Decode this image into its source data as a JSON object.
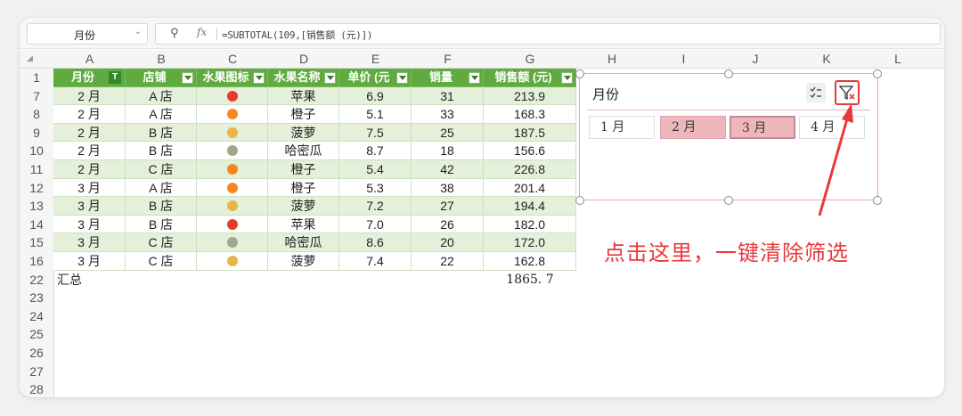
{
  "formula_bar": {
    "name_box": "月份",
    "formula": "=SUBTOTAL(109,[销售额 (元)])"
  },
  "columns": [
    "A",
    "B",
    "C",
    "D",
    "E",
    "F",
    "G",
    "H",
    "I",
    "J",
    "K",
    "L"
  ],
  "table": {
    "headers": [
      "月份",
      "店铺",
      "水果图标",
      "水果名称",
      "单价 (元",
      "销量",
      "销售额 (元)"
    ],
    "rows": [
      {
        "row": "7",
        "month": "2 月",
        "store": "A 店",
        "fruit_icon": "apple-icon",
        "fruit": "苹果",
        "price": "6.9",
        "qty": "31",
        "sales": "213.9"
      },
      {
        "row": "8",
        "month": "2 月",
        "store": "A 店",
        "fruit_icon": "orange-icon",
        "fruit": "橙子",
        "price": "5.1",
        "qty": "33",
        "sales": "168.3"
      },
      {
        "row": "9",
        "month": "2 月",
        "store": "B 店",
        "fruit_icon": "pineapple-icon",
        "fruit": "菠萝",
        "price": "7.5",
        "qty": "25",
        "sales": "187.5"
      },
      {
        "row": "10",
        "month": "2 月",
        "store": "B 店",
        "fruit_icon": "melon-icon",
        "fruit": "哈密瓜",
        "price": "8.7",
        "qty": "18",
        "sales": "156.6"
      },
      {
        "row": "11",
        "month": "2 月",
        "store": "C 店",
        "fruit_icon": "orange-icon",
        "fruit": "橙子",
        "price": "5.4",
        "qty": "42",
        "sales": "226.8"
      },
      {
        "row": "12",
        "month": "3 月",
        "store": "A 店",
        "fruit_icon": "orange-icon",
        "fruit": "橙子",
        "price": "5.3",
        "qty": "38",
        "sales": "201.4"
      },
      {
        "row": "13",
        "month": "3 月",
        "store": "B 店",
        "fruit_icon": "pineapple-icon",
        "fruit": "菠萝",
        "price": "7.2",
        "qty": "27",
        "sales": "194.4"
      },
      {
        "row": "14",
        "month": "3 月",
        "store": "B 店",
        "fruit_icon": "apple-icon",
        "fruit": "苹果",
        "price": "7.0",
        "qty": "26",
        "sales": "182.0"
      },
      {
        "row": "15",
        "month": "3 月",
        "store": "C 店",
        "fruit_icon": "melon-icon",
        "fruit": "哈密瓜",
        "price": "8.6",
        "qty": "20",
        "sales": "172.0"
      },
      {
        "row": "16",
        "month": "3 月",
        "store": "C 店",
        "fruit_icon": "pineapple-icon",
        "fruit": "菠萝",
        "price": "7.4",
        "qty": "22",
        "sales": "162.8"
      }
    ],
    "total_row": {
      "row": "22",
      "label": "汇总",
      "value": "1865. 7"
    },
    "empty_rows": [
      "23",
      "24",
      "25",
      "26",
      "27",
      "28"
    ]
  },
  "slicer": {
    "title": "月份",
    "items": [
      {
        "label": "1 月",
        "selected": false
      },
      {
        "label": "2 月",
        "selected": true
      },
      {
        "label": "3 月",
        "selected": true
      },
      {
        "label": "4 月",
        "selected": false
      }
    ]
  },
  "callout": "点击这里，一键清除筛选",
  "colors": {
    "header_green": "#5fab3f",
    "row_band": "#e4f0d9",
    "slicer_selected": "#f0b6bd",
    "annotation_red": "#e8383a"
  }
}
